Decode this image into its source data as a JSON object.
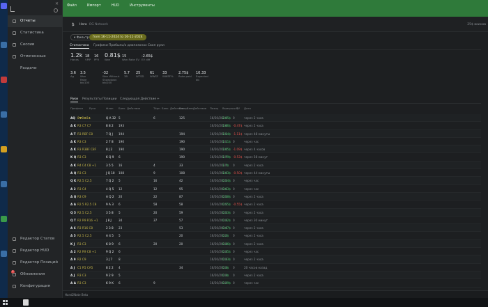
{
  "sidebar": {
    "items": [
      {
        "label": "Отчеты",
        "icon": "reports-icon"
      },
      {
        "label": "Статистика",
        "icon": "stats-icon"
      },
      {
        "label": "Сессии",
        "icon": "sessions-icon"
      },
      {
        "label": "Отмеченные Раздачи",
        "icon": "bookmark-icon"
      }
    ],
    "bottom": [
      {
        "label": "Редактор Статов",
        "icon": "stat-editor-icon"
      },
      {
        "label": "Редактор HUD",
        "icon": "hud-editor-icon"
      },
      {
        "label": "Редактор Позиций",
        "icon": "position-editor-icon"
      },
      {
        "label": "Обновления",
        "icon": "updates-icon",
        "badge": "1"
      },
      {
        "label": "Конфигурация",
        "icon": "config-icon"
      }
    ]
  },
  "menu": [
    "Файл",
    "Импорт",
    "HUD",
    "Инструменты"
  ],
  "header": {
    "pin": "$",
    "name": "Hero",
    "sub": "OG Network",
    "right": "25$ воинов"
  },
  "filters": {
    "filter_label": "Фильтр",
    "date_range": "from 16-11-2024 to 16-11-2024"
  },
  "stat_tabs": [
    "Статистика",
    "Графики",
    "Прибыль/о диапазонах",
    "Своя руки"
  ],
  "metrics_row1": [
    {
      "value": "1.2k",
      "label": "Hands"
    },
    {
      "value": "18",
      "label": "VPIP"
    },
    {
      "value": "16",
      "label": "PFR"
    },
    {
      "value": "0.81$",
      "label": "Won",
      "color": "green"
    },
    {
      "value": "15",
      "label": "Won Rake EV",
      "color": "green"
    },
    {
      "value": "-2.65$",
      "label": "EV diff",
      "color": "red"
    }
  ],
  "metrics_row2": [
    {
      "value": "3.6",
      "label": "Ag"
    },
    {
      "value": "3.5",
      "label": "Won Rake bb/100",
      "color": "green"
    },
    {
      "value": "-32",
      "label": "Won Without Showdown bb/100",
      "color": "red"
    },
    {
      "value": "5.7",
      "label": "3B"
    },
    {
      "value": "25",
      "label": "WTSD"
    },
    {
      "value": "61",
      "label": "WWSF"
    },
    {
      "value": "33",
      "label": "WWSF%"
    },
    {
      "value": "2.75$",
      "label": "Rake paid",
      "color": "yellow"
    },
    {
      "value": "10.33",
      "label": "Expected bb"
    }
  ],
  "table_tabs": [
    "Руки",
    "Результаты",
    "Позиции",
    "Следующая Действие"
  ],
  "table_tab_add": "+",
  "columns": [
    "Префлоп",
    "Рука",
    "Флоп",
    "Банк",
    "Действие",
    "Тёрн",
    "Банк",
    "Действие",
    "Ривер",
    "Банк",
    "Действие",
    "Позиц",
    "Выигрыш $",
    "EV",
    "Дата"
  ],
  "rows": [
    {
      "hand": "AQ",
      "flop": "8♥8♣8♠",
      "board": "Q A 32",
      "turn": "5",
      "river": "6",
      "pot": "125",
      "date": "16/20/2024",
      "won": "2.05$",
      "ev": "0",
      "time": "через 2 часа",
      "wc": "pos"
    },
    {
      "hand": "A K",
      "flop": "R3 C7 C7",
      "board": "8 8 2",
      "turn": "193",
      "river": "",
      "pot": "",
      "date": "16/20/2024",
      "won": "1.86$",
      "ev": "-0.47$",
      "time": "через 2 часа",
      "wc": "pos"
    },
    {
      "hand": "A T",
      "flop": "R3 RBF C8",
      "board": "7 Q J",
      "turn": "194",
      "river": "",
      "pot": "194",
      "date": "16/20/2024",
      "won": "1.54$",
      "ev": "-1.11$",
      "time": "через 48 минуты",
      "wc": "pos"
    },
    {
      "hand": "A K",
      "flop": "R3 C3",
      "board": "2 7 8",
      "turn": "190",
      "river": "",
      "pot": "190",
      "date": "16/20/2024",
      "won": "1.11$",
      "ev": "0",
      "time": "через час",
      "wc": "pos"
    },
    {
      "hand": "A K",
      "flop": "R3 R3BF C8F",
      "board": "8 J 2",
      "turn": "190",
      "river": "",
      "pot": "190",
      "date": "16/20/2024",
      "won": "1.05$",
      "ev": "-1.09$",
      "time": "через 4 часов",
      "wc": "pos"
    },
    {
      "hand": "K Q",
      "flop": "R3 C3",
      "board": "K Q 9",
      "turn": "6",
      "river": "",
      "pot": "190",
      "date": "16/20/2024",
      "won": "1.79$",
      "ev": "-0.53$",
      "time": "через 58 минут",
      "wc": "pos"
    },
    {
      "hand": "A K",
      "flop": "R4 C4 C8 +1",
      "board": "3 5 5",
      "turn": "16",
      "river": "4",
      "pot": "33",
      "date": "16/20/2024",
      "won": "1.7$",
      "ev": "0",
      "time": "через 2 часа",
      "wc": "pos"
    },
    {
      "hand": "A Q",
      "flop": "R3 C3",
      "board": "J Q 10",
      "turn": "108",
      "river": "9",
      "pot": "108",
      "date": "16/20/2024",
      "won": "1.03$",
      "ev": "-0.50$",
      "time": "через 44 минуты",
      "wc": "pos"
    },
    {
      "hand": "Q K",
      "flop": "R2.5 C2.5",
      "board": "7 Q 2",
      "turn": "5",
      "river": "16",
      "pot": "42",
      "date": "16/20/2024",
      "won": "0.54$",
      "ev": "0",
      "time": "через час",
      "wc": "pos"
    },
    {
      "hand": "A 2",
      "flop": "R3 C4",
      "board": "4 Q 5",
      "turn": "12",
      "river": "12",
      "pot": "95",
      "date": "16/20/2024",
      "won": "0.63$",
      "ev": "0",
      "time": "через час",
      "wc": "pos"
    },
    {
      "hand": "A Q",
      "flop": "R3 C9",
      "board": "A Q 2",
      "turn": "20",
      "river": "22",
      "pot": "87",
      "date": "16/20/2024",
      "won": "0.58$",
      "ev": "0",
      "time": "через 2 часа",
      "wc": "pos"
    },
    {
      "hand": "A A",
      "flop": "R2.5 R2.5 C8",
      "board": "9 A 3",
      "turn": "6",
      "river": "58",
      "pot": "58",
      "date": "16/20/2024",
      "won": "0.55$",
      "ev": "-0.55$",
      "time": "через 2 часа",
      "wc": "pos"
    },
    {
      "hand": "Q 5",
      "flop": "R2.5 C2.5",
      "board": "3 5 8",
      "turn": "5",
      "river": "20",
      "pot": "59",
      "date": "16/20/2024",
      "won": "0.53$",
      "ev": "0",
      "time": "через 2 часа",
      "wc": "pos"
    },
    {
      "hand": "Q T",
      "flop": "R2 R9 R16 +1",
      "board": "J 8 J",
      "turn": "34",
      "river": "37",
      "pot": "57",
      "date": "16/20/2024",
      "won": "0.32$",
      "ev": "0",
      "time": "через 30 минут",
      "wc": "pos"
    },
    {
      "hand": "A 6",
      "flop": "R3 R16 C8",
      "board": "2 3 8",
      "turn": "23",
      "river": "",
      "pot": "53",
      "date": "16/20/2024",
      "won": "0.47$",
      "ev": "0",
      "time": "через 2 часа",
      "wc": "pos"
    },
    {
      "hand": "A 5",
      "flop": "R2.5 C2.5",
      "board": "A 4 5",
      "turn": "5",
      "river": "",
      "pot": "20",
      "date": "16/20/2024",
      "won": "0.2$",
      "ev": "0",
      "time": "через 2 часа",
      "wc": "pos"
    },
    {
      "hand": "K J",
      "flop": "R3 C3",
      "board": "K 8 9",
      "turn": "6",
      "river": "20",
      "pot": "20",
      "date": "16/20/2024",
      "won": "0.36$",
      "ev": "0",
      "time": "через 2 часа",
      "wc": "pos"
    },
    {
      "hand": "A 2",
      "flop": "R2 R9 C8 +1",
      "board": "9 Q 2",
      "turn": "6",
      "river": "",
      "pot": "",
      "date": "16/20/2024",
      "won": "0.35$",
      "ev": "0",
      "time": "через час",
      "wc": "pos"
    },
    {
      "hand": "A 9",
      "flop": "R2 C9",
      "board": "3 J 7",
      "turn": "8",
      "river": "",
      "pot": "",
      "date": "16/20/2024",
      "won": "0.33$",
      "ev": "0",
      "time": "через 2 часа",
      "wc": "pos"
    },
    {
      "hand": "A J",
      "flop": "C1 R5 CA5",
      "board": "8 2 2",
      "turn": "4",
      "river": "",
      "pot": "34",
      "date": "16/20/2024",
      "won": "0.3$",
      "ev": "0",
      "time": "20 часов назад",
      "wc": "pos"
    },
    {
      "hand": "A J",
      "flop": "R3 C3",
      "board": "9 2 9",
      "turn": "5",
      "river": "",
      "pot": "",
      "date": "16/20/2024",
      "won": "0.3$",
      "ev": "0",
      "time": "через 2 часа",
      "wc": "pos"
    },
    {
      "hand": "A A",
      "flop": "R3 C3",
      "board": "K 9 K",
      "turn": "6",
      "river": "9",
      "pot": "",
      "date": "16/20/2024",
      "won": "0.29$",
      "ev": "0",
      "time": "через час",
      "wc": "pos"
    }
  ],
  "footer": "Hand2Note Beta",
  "colors": {
    "accent": "#2f7a3a",
    "positive": "#4bc06a",
    "negative": "#e0524a",
    "pill": "#6a6c1e"
  }
}
